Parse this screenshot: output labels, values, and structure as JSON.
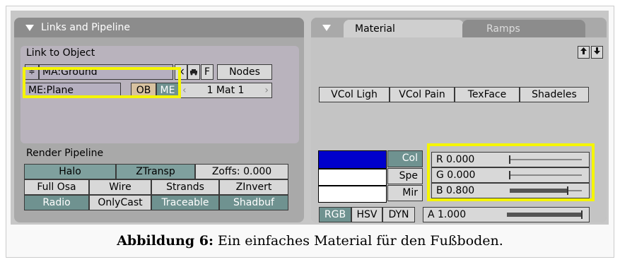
{
  "links_panel": {
    "title": "Links and Pipeline",
    "link_to_object_label": "Link to Object",
    "material_field": "MA:Ground",
    "material_prefix": "≑",
    "x_label": "×",
    "fake_user_label": "F",
    "nodes_label": "Nodes",
    "mesh_field": "ME:Plane",
    "ob_label": "OB",
    "me_label": "ME",
    "mat_counter": "1 Mat 1",
    "render_pipeline_label": "Render Pipeline",
    "pipeline_buttons": [
      [
        "Halo",
        "ZTransp",
        "Zoffs: 0.000"
      ],
      [
        "Full Osa",
        "Wire",
        "Strands",
        "ZInvert"
      ],
      [
        "Radio",
        "OnlyCast",
        "Traceable",
        "Shadbuf"
      ]
    ]
  },
  "material_panel": {
    "tabs": [
      "Material",
      "Ramps"
    ],
    "mode_buttons": [
      "VCol Ligh",
      "VCol Pain",
      "TexFace",
      "Shadeles"
    ],
    "color_buttons": [
      "Col",
      "Spe",
      "Mir"
    ],
    "rgb_values": [
      {
        "label": "R 0.000",
        "value": 0.0
      },
      {
        "label": "G 0.000",
        "value": 0.0
      },
      {
        "label": "B 0.800",
        "value": 0.8
      }
    ],
    "color_models": [
      "RGB",
      "HSV",
      "DYN"
    ],
    "alpha": {
      "label": "A 1.000",
      "value": 1.0
    },
    "swatch_colors": [
      "#0000cc",
      "#ffffff",
      "#ffffff"
    ]
  },
  "caption": {
    "bold": "Abbildung 6:",
    "text": " Ein einfaches Material für den Fußboden."
  }
}
